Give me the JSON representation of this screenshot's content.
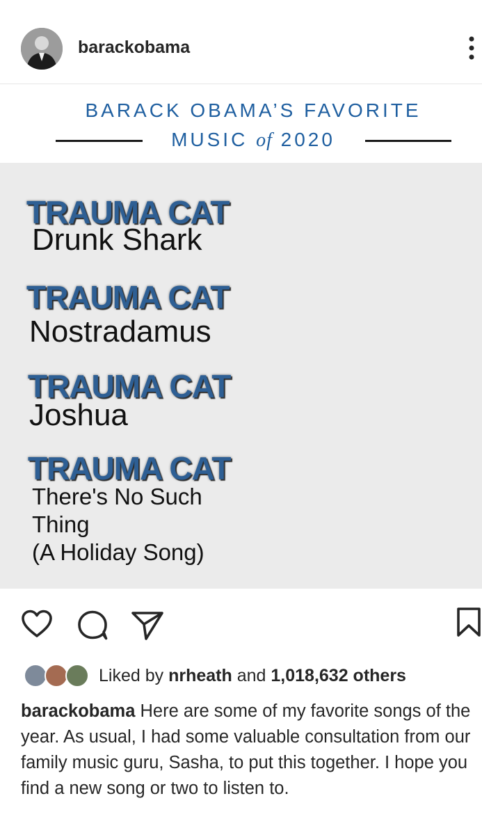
{
  "header": {
    "username": "barackobama"
  },
  "banner": {
    "line1": "BARACK OBAMA’S FAVORITE",
    "line2_pre": "MUSIC",
    "line2_of": "of",
    "line2_post": "2020"
  },
  "tracks": [
    {
      "artist": "TRAUMA CAT",
      "song": "Drunk Shark"
    },
    {
      "artist": "TRAUMA CAT",
      "song": "Nostradamus"
    },
    {
      "artist": "TRAUMA CAT",
      "song": "Joshua"
    },
    {
      "artist": "TRAUMA CAT",
      "song_lines": [
        "There's No Such",
        "Thing",
        "(A Holiday Song)"
      ]
    }
  ],
  "likes": {
    "prefix": "Liked by",
    "user": "nrheath",
    "and": "and",
    "count": "1,018,632 others"
  },
  "caption": {
    "username": "barackobama",
    "text": "Here are some of my favorite songs of the year. As usual, I had some valuable consultation from our family music guru, Sasha, to put this together. I hope you find a new song or two to listen to."
  },
  "icons": {
    "more": "more-vertical-icon",
    "like": "heart-icon",
    "comment": "comment-icon",
    "share": "send-icon",
    "save": "bookmark-icon"
  },
  "colors": {
    "banner_blue": "#1f5fa0",
    "artist_blue": "#2e5f94",
    "image_bg": "#ebebeb",
    "text": "#262626"
  }
}
